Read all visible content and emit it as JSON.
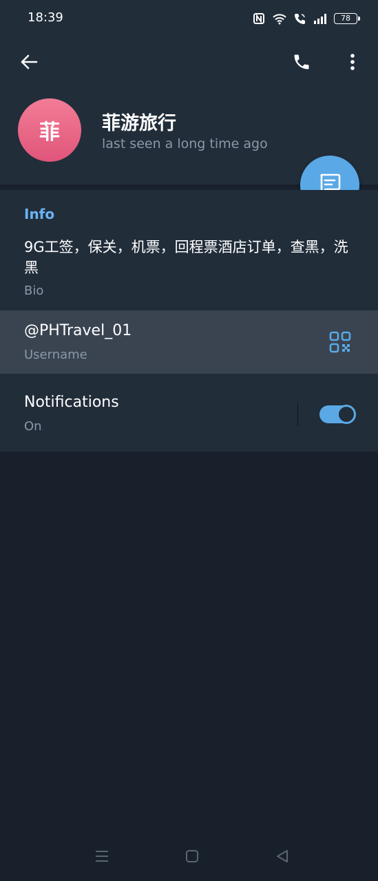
{
  "status_bar": {
    "time": "18:39",
    "battery": "78",
    "icons": [
      "nfc-icon",
      "wifi-icon",
      "wifi-call-icon",
      "signal-icon",
      "battery-icon"
    ]
  },
  "toolbar": {
    "back_icon": "arrow-left-icon",
    "call_icon": "phone-icon",
    "more_icon": "more-vertical-icon"
  },
  "profile": {
    "avatar_letter": "菲",
    "name": "菲游旅行",
    "status": "last seen a long time ago",
    "avatar_color_top": "#f27d96",
    "avatar_color_bottom": "#e0557a"
  },
  "fab": {
    "icon": "message-icon",
    "color": "#5aa9e6"
  },
  "info": {
    "title": "Info",
    "bio": "9G工签，保关，机票，回程票酒店订单，查黑，洗黑",
    "bio_label": "Bio",
    "username": "@PHTravel_01",
    "username_label": "Username",
    "qr_icon": "qr-code-icon",
    "notifications_label": "Notifications",
    "notifications_status": "On",
    "notifications_enabled": true
  },
  "nav_bar": {
    "icons": [
      "menu-icon",
      "home-icon",
      "back-triangle-icon"
    ]
  },
  "colors": {
    "background": "#18202b",
    "surface": "#222d3a",
    "accent": "#5aa9e6",
    "title_accent": "#6ab3f3",
    "secondary_text": "#8a98a8",
    "highlight_row": "#3a4450"
  }
}
